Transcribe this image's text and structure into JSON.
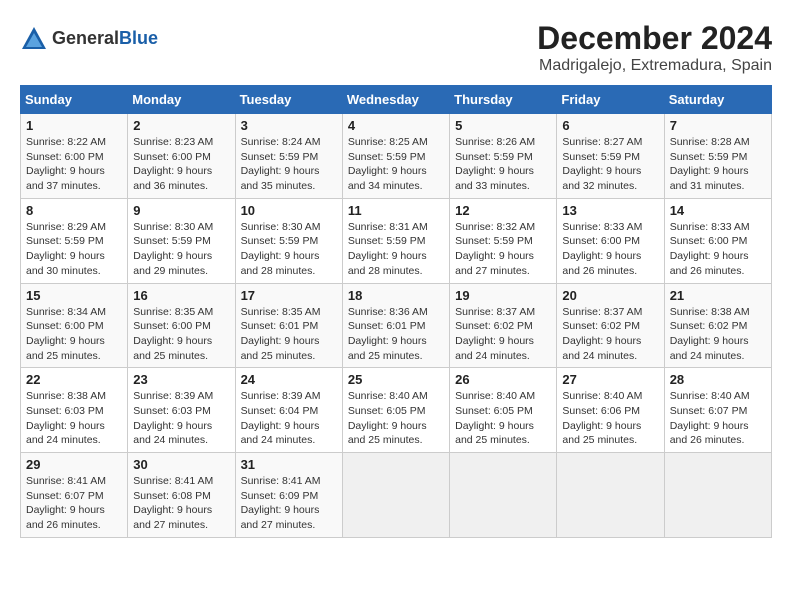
{
  "header": {
    "logo_general": "General",
    "logo_blue": "Blue",
    "title": "December 2024",
    "subtitle": "Madrigalejo, Extremadura, Spain"
  },
  "calendar": {
    "days_of_week": [
      "Sunday",
      "Monday",
      "Tuesday",
      "Wednesday",
      "Thursday",
      "Friday",
      "Saturday"
    ],
    "weeks": [
      [
        {
          "day": "",
          "empty": true
        },
        {
          "day": "",
          "empty": true
        },
        {
          "day": "3",
          "sunrise": "Sunrise: 8:24 AM",
          "sunset": "Sunset: 5:59 PM",
          "daylight": "Daylight: 9 hours and 35 minutes."
        },
        {
          "day": "4",
          "sunrise": "Sunrise: 8:25 AM",
          "sunset": "Sunset: 5:59 PM",
          "daylight": "Daylight: 9 hours and 34 minutes."
        },
        {
          "day": "5",
          "sunrise": "Sunrise: 8:26 AM",
          "sunset": "Sunset: 5:59 PM",
          "daylight": "Daylight: 9 hours and 33 minutes."
        },
        {
          "day": "6",
          "sunrise": "Sunrise: 8:27 AM",
          "sunset": "Sunset: 5:59 PM",
          "daylight": "Daylight: 9 hours and 32 minutes."
        },
        {
          "day": "7",
          "sunrise": "Sunrise: 8:28 AM",
          "sunset": "Sunset: 5:59 PM",
          "daylight": "Daylight: 9 hours and 31 minutes."
        }
      ],
      [
        {
          "day": "1",
          "sunrise": "Sunrise: 8:22 AM",
          "sunset": "Sunset: 6:00 PM",
          "daylight": "Daylight: 9 hours and 37 minutes."
        },
        {
          "day": "2",
          "sunrise": "Sunrise: 8:23 AM",
          "sunset": "Sunset: 6:00 PM",
          "daylight": "Daylight: 9 hours and 36 minutes."
        },
        {
          "day": "",
          "empty": true
        },
        {
          "day": "",
          "empty": true
        },
        {
          "day": "",
          "empty": true
        },
        {
          "day": "",
          "empty": true
        },
        {
          "day": "",
          "empty": true
        }
      ],
      [
        {
          "day": "8",
          "sunrise": "Sunrise: 8:29 AM",
          "sunset": "Sunset: 5:59 PM",
          "daylight": "Daylight: 9 hours and 30 minutes."
        },
        {
          "day": "9",
          "sunrise": "Sunrise: 8:30 AM",
          "sunset": "Sunset: 5:59 PM",
          "daylight": "Daylight: 9 hours and 29 minutes."
        },
        {
          "day": "10",
          "sunrise": "Sunrise: 8:30 AM",
          "sunset": "Sunset: 5:59 PM",
          "daylight": "Daylight: 9 hours and 28 minutes."
        },
        {
          "day": "11",
          "sunrise": "Sunrise: 8:31 AM",
          "sunset": "Sunset: 5:59 PM",
          "daylight": "Daylight: 9 hours and 28 minutes."
        },
        {
          "day": "12",
          "sunrise": "Sunrise: 8:32 AM",
          "sunset": "Sunset: 5:59 PM",
          "daylight": "Daylight: 9 hours and 27 minutes."
        },
        {
          "day": "13",
          "sunrise": "Sunrise: 8:33 AM",
          "sunset": "Sunset: 6:00 PM",
          "daylight": "Daylight: 9 hours and 26 minutes."
        },
        {
          "day": "14",
          "sunrise": "Sunrise: 8:33 AM",
          "sunset": "Sunset: 6:00 PM",
          "daylight": "Daylight: 9 hours and 26 minutes."
        }
      ],
      [
        {
          "day": "15",
          "sunrise": "Sunrise: 8:34 AM",
          "sunset": "Sunset: 6:00 PM",
          "daylight": "Daylight: 9 hours and 25 minutes."
        },
        {
          "day": "16",
          "sunrise": "Sunrise: 8:35 AM",
          "sunset": "Sunset: 6:00 PM",
          "daylight": "Daylight: 9 hours and 25 minutes."
        },
        {
          "day": "17",
          "sunrise": "Sunrise: 8:35 AM",
          "sunset": "Sunset: 6:01 PM",
          "daylight": "Daylight: 9 hours and 25 minutes."
        },
        {
          "day": "18",
          "sunrise": "Sunrise: 8:36 AM",
          "sunset": "Sunset: 6:01 PM",
          "daylight": "Daylight: 9 hours and 25 minutes."
        },
        {
          "day": "19",
          "sunrise": "Sunrise: 8:37 AM",
          "sunset": "Sunset: 6:02 PM",
          "daylight": "Daylight: 9 hours and 24 minutes."
        },
        {
          "day": "20",
          "sunrise": "Sunrise: 8:37 AM",
          "sunset": "Sunset: 6:02 PM",
          "daylight": "Daylight: 9 hours and 24 minutes."
        },
        {
          "day": "21",
          "sunrise": "Sunrise: 8:38 AM",
          "sunset": "Sunset: 6:02 PM",
          "daylight": "Daylight: 9 hours and 24 minutes."
        }
      ],
      [
        {
          "day": "22",
          "sunrise": "Sunrise: 8:38 AM",
          "sunset": "Sunset: 6:03 PM",
          "daylight": "Daylight: 9 hours and 24 minutes."
        },
        {
          "day": "23",
          "sunrise": "Sunrise: 8:39 AM",
          "sunset": "Sunset: 6:03 PM",
          "daylight": "Daylight: 9 hours and 24 minutes."
        },
        {
          "day": "24",
          "sunrise": "Sunrise: 8:39 AM",
          "sunset": "Sunset: 6:04 PM",
          "daylight": "Daylight: 9 hours and 24 minutes."
        },
        {
          "day": "25",
          "sunrise": "Sunrise: 8:40 AM",
          "sunset": "Sunset: 6:05 PM",
          "daylight": "Daylight: 9 hours and 25 minutes."
        },
        {
          "day": "26",
          "sunrise": "Sunrise: 8:40 AM",
          "sunset": "Sunset: 6:05 PM",
          "daylight": "Daylight: 9 hours and 25 minutes."
        },
        {
          "day": "27",
          "sunrise": "Sunrise: 8:40 AM",
          "sunset": "Sunset: 6:06 PM",
          "daylight": "Daylight: 9 hours and 25 minutes."
        },
        {
          "day": "28",
          "sunrise": "Sunrise: 8:40 AM",
          "sunset": "Sunset: 6:07 PM",
          "daylight": "Daylight: 9 hours and 26 minutes."
        }
      ],
      [
        {
          "day": "29",
          "sunrise": "Sunrise: 8:41 AM",
          "sunset": "Sunset: 6:07 PM",
          "daylight": "Daylight: 9 hours and 26 minutes."
        },
        {
          "day": "30",
          "sunrise": "Sunrise: 8:41 AM",
          "sunset": "Sunset: 6:08 PM",
          "daylight": "Daylight: 9 hours and 27 minutes."
        },
        {
          "day": "31",
          "sunrise": "Sunrise: 8:41 AM",
          "sunset": "Sunset: 6:09 PM",
          "daylight": "Daylight: 9 hours and 27 minutes."
        },
        {
          "day": "",
          "empty": true
        },
        {
          "day": "",
          "empty": true
        },
        {
          "day": "",
          "empty": true
        },
        {
          "day": "",
          "empty": true
        }
      ]
    ]
  }
}
